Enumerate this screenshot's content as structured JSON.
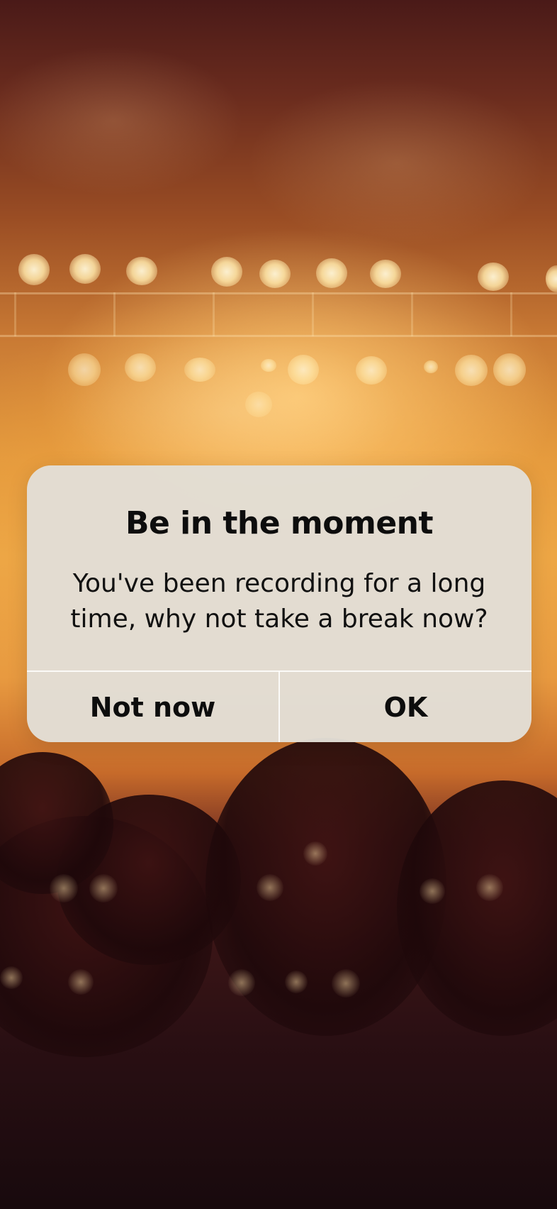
{
  "alert": {
    "title": "Be in the moment",
    "message": "You've been recording for a long time, why not take a break now?",
    "secondary_button_label": "Not now",
    "primary_button_label": "OK"
  },
  "background": {
    "description_colors": {
      "top": "#4a1a18",
      "glow": "#eca848",
      "bottom": "#180a0d"
    }
  },
  "colors": {
    "alert_background": "#e2ded6",
    "text": "#0d0d0d",
    "divider": "#ffffff"
  }
}
